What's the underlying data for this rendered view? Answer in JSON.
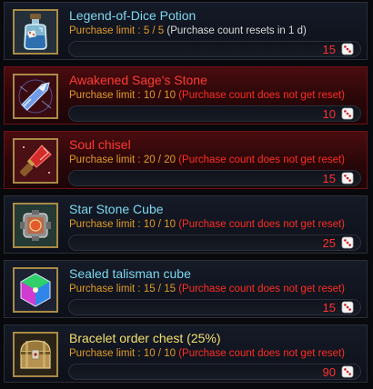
{
  "items": [
    {
      "name": "Legend-of-Dice Potion",
      "limit_label": "Purchase limit : ",
      "limit_count": "5 / 5",
      "limit_note": "(Purchase count resets in 1 d)",
      "price": "15",
      "icon": "potion-bottle-icon",
      "theme": "normal"
    },
    {
      "name": "Awakened Sage's Stone",
      "limit_label": "Purchase limit : ",
      "limit_count": "10 / 10",
      "limit_note": "(Purchase count does not get reset)",
      "price": "10",
      "icon": "sage-stone-icon",
      "theme": "red"
    },
    {
      "name": "Soul chisel",
      "limit_label": "Purchase limit : ",
      "limit_count": "20 / 20",
      "limit_note": "(Purchase count does not get reset)",
      "price": "15",
      "icon": "chisel-icon",
      "theme": "red"
    },
    {
      "name": "Star Stone Cube",
      "limit_label": "Purchase limit : ",
      "limit_count": "10 / 10",
      "limit_note": "(Purchase count does not get reset)",
      "price": "25",
      "icon": "star-stone-cube-icon",
      "theme": "normal"
    },
    {
      "name": "Sealed talisman cube",
      "limit_label": "Purchase limit : ",
      "limit_count": "15 / 15",
      "limit_note": "(Purchase count does not get reset)",
      "price": "15",
      "icon": "talisman-cube-icon",
      "theme": "normal"
    },
    {
      "name": "Bracelet order chest (25%)",
      "limit_label": "Purchase limit : ",
      "limit_count": "10 / 10",
      "limit_note": "(Purchase count does not get reset)",
      "price": "90",
      "icon": "treasure-chest-icon",
      "theme": "normal",
      "title_color": "gold"
    }
  ],
  "currency_icon": "dice-icon"
}
